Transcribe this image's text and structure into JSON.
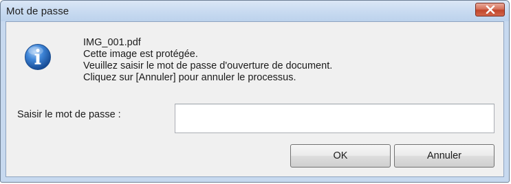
{
  "window": {
    "title": "Mot de passe",
    "close_icon": "close-icon"
  },
  "message": {
    "icon": "info-icon",
    "lines": [
      "IMG_001.pdf",
      "Cette image est protégée.",
      "Veuillez saisir le mot de passe d'ouverture de document.",
      "Cliquez sur [Annuler] pour annuler le processus."
    ]
  },
  "password": {
    "label": "Saisir le mot de passe :",
    "value": "",
    "placeholder": ""
  },
  "buttons": {
    "ok_label": "OK",
    "cancel_label": "Annuler"
  },
  "colors": {
    "titlebar": "#c9dbf1",
    "close_button": "#c2452b",
    "client_background": "#f0f0f0",
    "info_icon": "#1f5fb4"
  }
}
